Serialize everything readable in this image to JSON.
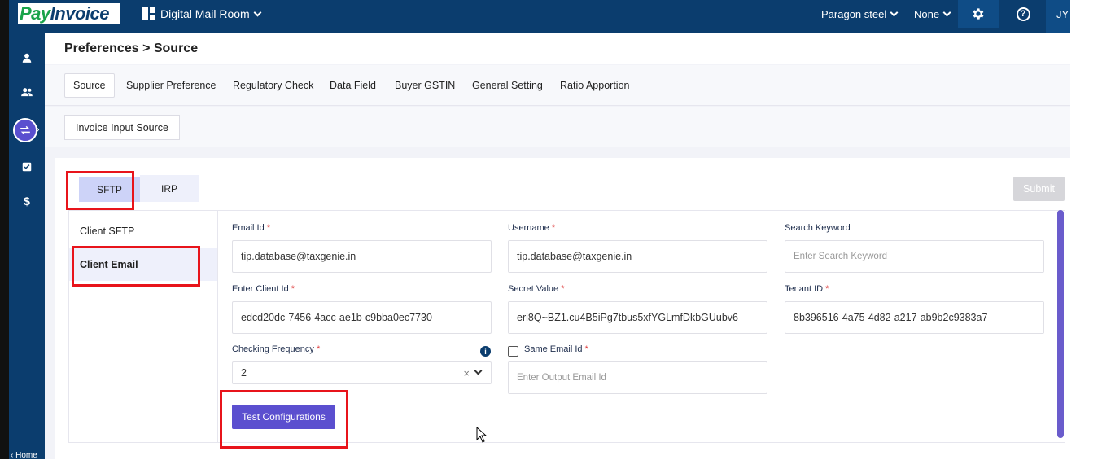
{
  "brand": {
    "logo_part1": "Pay",
    "logo_part2": "Invoice"
  },
  "header": {
    "app_name": "Digital Mail Room",
    "company": "Paragon steel",
    "scope": "None",
    "help": "?",
    "user_initials": "JY"
  },
  "sidebar": {
    "items": [
      "user-icon",
      "users-icon",
      "transfer-icon",
      "checklist-icon",
      "dollar-icon"
    ],
    "dollar": "$",
    "home_label": "Home"
  },
  "page": {
    "title": "Preferences > Source",
    "tabs": [
      {
        "label": "Source",
        "active": true
      },
      {
        "label": "Supplier Preference"
      },
      {
        "label": "Regulatory Check"
      },
      {
        "label": "Data Field"
      },
      {
        "label": "Buyer GSTIN"
      },
      {
        "label": "General Setting"
      },
      {
        "label": "Ratio Apportion"
      }
    ],
    "subtab": "Invoice Input Source"
  },
  "source": {
    "modes": [
      "SFTP",
      "IRP"
    ],
    "active_mode": "SFTP",
    "submit_label": "Submit",
    "left_nav": [
      "Client SFTP",
      "Client Email"
    ],
    "selected_nav": "Client Email"
  },
  "form": {
    "email_id": {
      "label": "Email Id",
      "value": "tip.database@taxgenie.in"
    },
    "username": {
      "label": "Username",
      "value": "tip.database@taxgenie.in"
    },
    "search_keyword": {
      "label": "Search Keyword",
      "placeholder": "Enter Search Keyword"
    },
    "client_id": {
      "label": "Enter Client Id",
      "value": "edcd20dc-7456-4acc-ae1b-c9bba0ec7730"
    },
    "secret_value": {
      "label": "Secret Value",
      "value": "eri8Q~BZ1.cu4B5iPg7tbus5xfYGLmfDkbGUubv6"
    },
    "tenant_id": {
      "label": "Tenant ID",
      "value": "8b396516-4a75-4d82-a217-ab9b2c9383a7"
    },
    "checking_frequency": {
      "label": "Checking Frequency",
      "value": "2",
      "clear": "×"
    },
    "same_email": {
      "label": "Same Email Id",
      "checked": false
    },
    "output_email": {
      "placeholder": "Enter Output Email Id"
    },
    "required_mark": "*",
    "info": "i",
    "test_label": "Test Configurations"
  },
  "colors": {
    "header_bg": "#0b3d6e",
    "accent": "#5b4fcf",
    "highlight": "#e8141b"
  }
}
